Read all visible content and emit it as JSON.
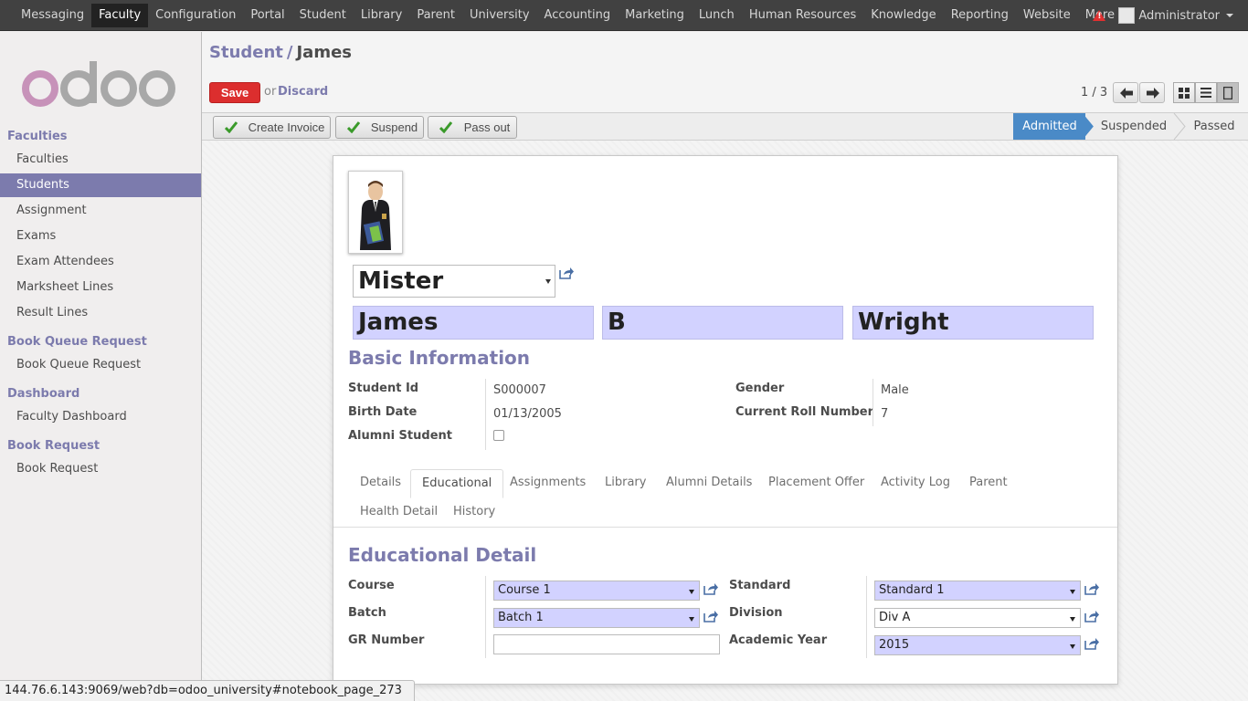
{
  "topnav": {
    "items": [
      "Messaging",
      "Faculty",
      "Configuration",
      "Portal",
      "Student",
      "Library",
      "Parent",
      "University",
      "Accounting",
      "Marketing",
      "Lunch",
      "Human Resources",
      "Knowledge",
      "Reporting",
      "Website",
      "More"
    ],
    "active_index": 1,
    "user": "Administrator"
  },
  "sidebar": {
    "sections": [
      {
        "title": "Faculties",
        "items": [
          "Faculties",
          "Students",
          "Assignment",
          "Exams",
          "Exam Attendees",
          "Marksheet Lines",
          "Result Lines"
        ]
      },
      {
        "title": "Book Queue Request",
        "items": [
          "Book Queue Request"
        ]
      },
      {
        "title": "Dashboard",
        "items": [
          "Faculty Dashboard"
        ]
      },
      {
        "title": "Book Request",
        "items": [
          "Book Request"
        ]
      }
    ],
    "active_item": "Students"
  },
  "breadcrumb": {
    "parent": "Student",
    "separator": "/",
    "current": "James"
  },
  "actions": {
    "save": "Save",
    "or": "or",
    "discard": "Discard"
  },
  "pager": {
    "text": "1 / 3"
  },
  "statusbar": {
    "buttons": [
      "Create Invoice",
      "Suspend",
      "Pass out"
    ],
    "stages": [
      "Admitted",
      "Suspended",
      "Passed"
    ],
    "active_stage": "Admitted"
  },
  "record": {
    "title": "Mister",
    "first_name": "James",
    "middle_name": "B",
    "last_name": "Wright"
  },
  "basic_info": {
    "title": "Basic Information",
    "student_id_label": "Student Id",
    "student_id": "S000007",
    "birth_date_label": "Birth Date",
    "birth_date": "01/13/2005",
    "alumni_label": "Alumni Student",
    "gender_label": "Gender",
    "gender": "Male",
    "roll_label": "Current Roll Number",
    "roll": "7"
  },
  "tabs": [
    "Details",
    "Educational",
    "Assignments",
    "Library",
    "Alumni Details",
    "Placement Offer",
    "Activity Log",
    "Parent",
    "Health Detail",
    "History"
  ],
  "active_tab": "Educational",
  "educational": {
    "title": "Educational Detail",
    "course_label": "Course",
    "course": "Course 1",
    "batch_label": "Batch",
    "batch": "Batch 1",
    "gr_label": "GR Number",
    "gr": "",
    "standard_label": "Standard",
    "standard": "Standard 1",
    "division_label": "Division",
    "division": "Div A",
    "year_label": "Academic Year",
    "year": "2015"
  },
  "status_url": "144.76.6.143:9069/web?db=odoo_university#notebook_page_273",
  "colors": {
    "accent": "#7c7bad",
    "save": "#dc2e2e",
    "stage_active": "#4a8ac7",
    "required_field": "#d2d2ff"
  }
}
